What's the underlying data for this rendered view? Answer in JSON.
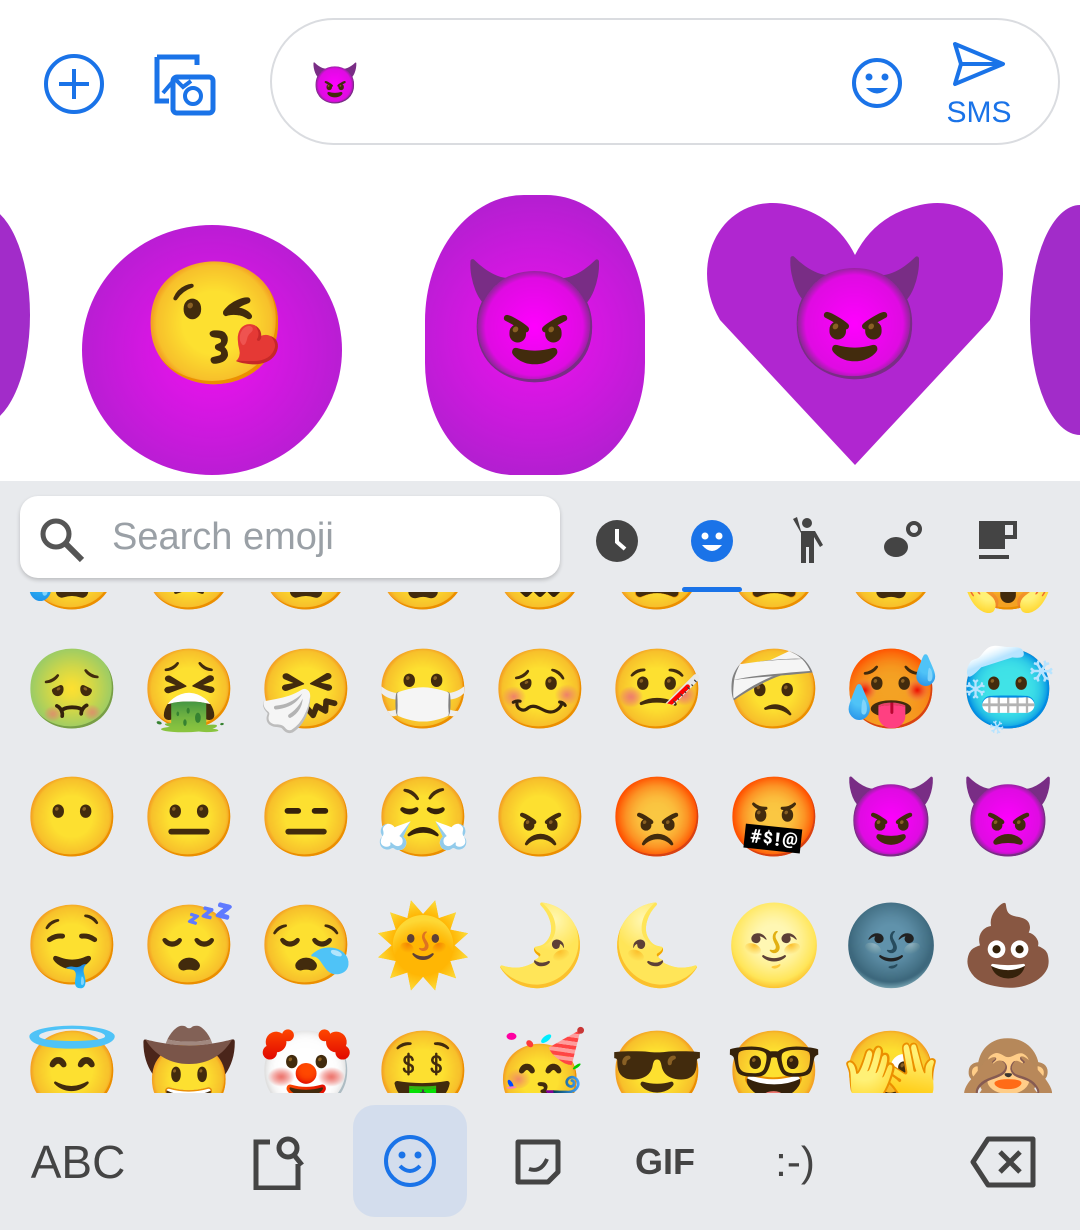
{
  "compose": {
    "current_emoji": "😈",
    "send_label": "SMS"
  },
  "stickers": [
    {
      "face": "😘"
    },
    {
      "face": "😈"
    },
    {
      "face": "😈"
    }
  ],
  "search": {
    "placeholder": "Search emoji"
  },
  "categories": [
    {
      "name": "recent",
      "active": false
    },
    {
      "name": "smileys",
      "active": true
    },
    {
      "name": "people",
      "active": false
    },
    {
      "name": "animals-nature",
      "active": false
    },
    {
      "name": "food-drink",
      "active": false
    }
  ],
  "emoji_rows": [
    [
      "😰",
      "😟",
      "😦",
      "😧",
      "😖",
      "😫",
      "😩",
      "😨",
      "😱"
    ],
    [
      "🤢",
      "🤮",
      "🤧",
      "😷",
      "🥴",
      "🤒",
      "🤕",
      "🥵",
      "🥶"
    ],
    [
      "😶",
      "😐",
      "😑",
      "😤",
      "😠",
      "😡",
      "🤬",
      "😈",
      "👿"
    ],
    [
      "🤤",
      "😴",
      "😪",
      "🌞",
      "🌛",
      "🌜",
      "🌝",
      "🌚",
      "💩"
    ],
    [
      "😇",
      "🤠",
      "🤡",
      "🤑",
      "🥳",
      "😎",
      "🤓",
      "🫣",
      "🙈"
    ]
  ],
  "bottom_bar": {
    "abc": "ABC",
    "gif": "GIF",
    "emoticon": ":-)"
  },
  "colors": {
    "accent": "#1a73e8",
    "keyboard_bg": "#e8eaed",
    "active_key_bg": "#d3dded",
    "icon": "#444444"
  }
}
